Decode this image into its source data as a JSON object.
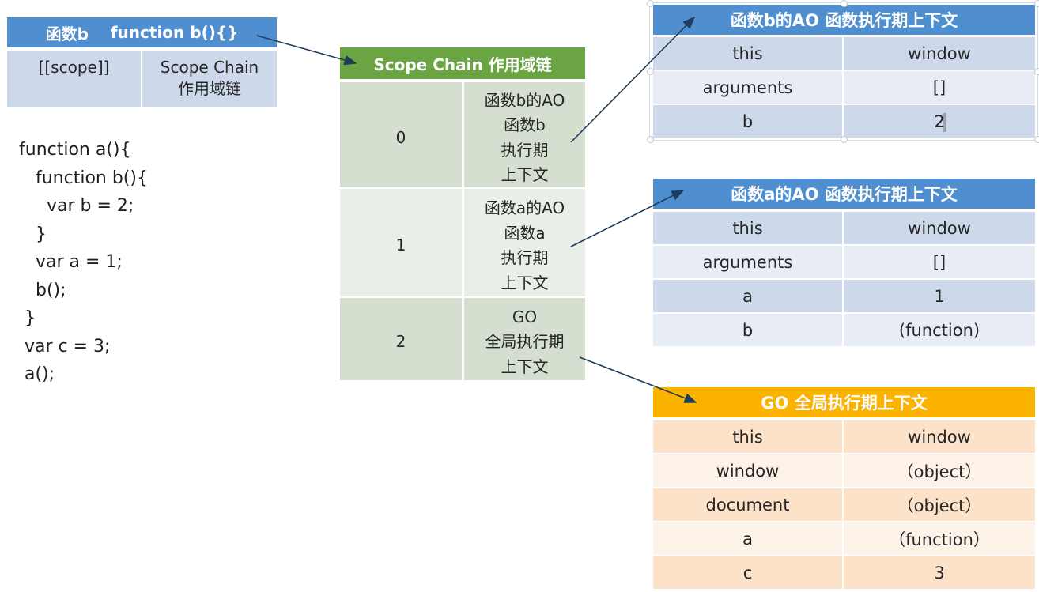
{
  "function_b_object": {
    "header": {
      "left": "函数b",
      "right": "function b(){}"
    },
    "cells": [
      "[[scope]]",
      "Scope Chain\n作用域链"
    ]
  },
  "code_lines": [
    "function a(){",
    "   function b(){",
    "     var b = 2;",
    "   }",
    "   var a = 1;",
    "   b();",
    " }",
    " var c = 3;",
    " a();"
  ],
  "scope_chain": {
    "title": "Scope Chain 作用域链",
    "rows": [
      {
        "index": "0",
        "lines": [
          "函数b的AO",
          "函数b",
          "执行期",
          "上下文"
        ]
      },
      {
        "index": "1",
        "lines": [
          "函数a的AO",
          "函数a",
          "执行期",
          "上下文"
        ]
      },
      {
        "index": "2",
        "lines": [
          "GO",
          "全局执行期",
          "上下文"
        ]
      }
    ]
  },
  "ao_b": {
    "title": "函数b的AO 函数执行期上下文",
    "rows": [
      [
        "this",
        "window"
      ],
      [
        "arguments",
        "[]"
      ],
      [
        "b",
        "2"
      ]
    ]
  },
  "ao_a": {
    "title": "函数a的AO 函数执行期上下文",
    "rows": [
      [
        "this",
        "window"
      ],
      [
        "arguments",
        "[]"
      ],
      [
        "a",
        "1"
      ],
      [
        "b",
        "(function)"
      ]
    ]
  },
  "go": {
    "title": "GO 全局执行期上下文",
    "rows": [
      [
        "this",
        "window"
      ],
      [
        "window",
        "（object）"
      ],
      [
        "document",
        "（object）"
      ],
      [
        "a",
        "（function）"
      ],
      [
        "c",
        "3"
      ]
    ]
  },
  "colors": {
    "blue_header": "#4f8fd0",
    "green_header": "#6aa443",
    "orange_header": "#fbb300",
    "arrow": "#1f3a5a"
  }
}
